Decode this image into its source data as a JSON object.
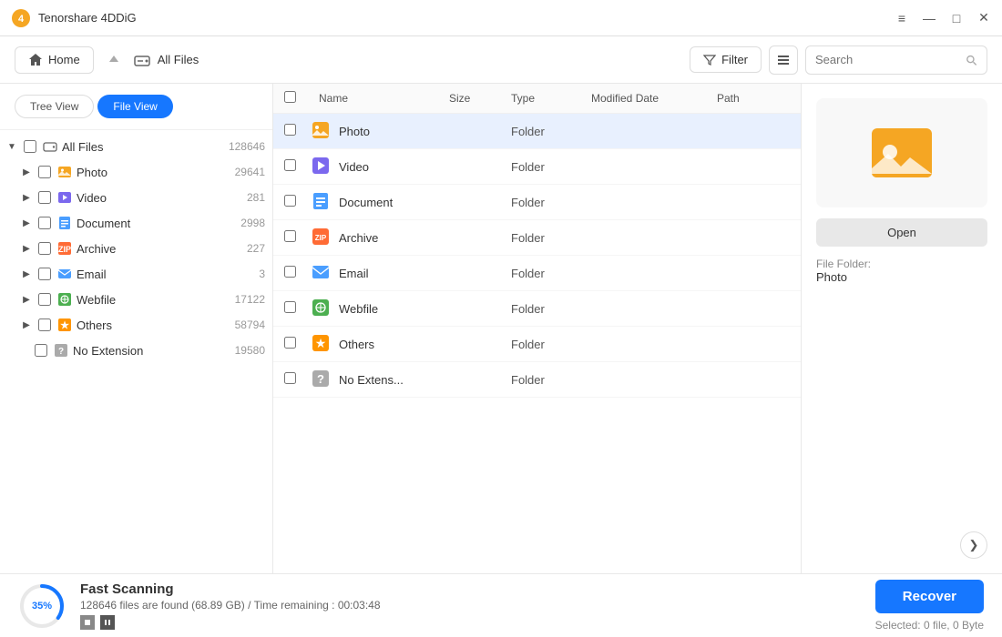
{
  "app": {
    "title": "Tenorshare 4DDiG",
    "logo_color": "#f5a623"
  },
  "titlebar": {
    "controls": {
      "menu": "≡",
      "minimize": "—",
      "maximize": "□",
      "close": "✕"
    }
  },
  "toolbar": {
    "home_label": "Home",
    "nav_up": "↑",
    "breadcrumb": "All Files",
    "filter_label": "Filter",
    "search_placeholder": "Search"
  },
  "sidebar": {
    "view_toggle": {
      "tree_view": "Tree View",
      "file_view": "File View"
    },
    "items": [
      {
        "id": "all-files",
        "label": "All Files",
        "count": "128646",
        "indent": 0,
        "has_arrow": true,
        "expanded": true,
        "icon": "hdd"
      },
      {
        "id": "photo",
        "label": "Photo",
        "count": "29641",
        "indent": 1,
        "has_arrow": true,
        "expanded": false,
        "icon": "photo"
      },
      {
        "id": "video",
        "label": "Video",
        "count": "281",
        "indent": 1,
        "has_arrow": true,
        "expanded": false,
        "icon": "video"
      },
      {
        "id": "document",
        "label": "Document",
        "count": "2998",
        "indent": 1,
        "has_arrow": true,
        "expanded": false,
        "icon": "document"
      },
      {
        "id": "archive",
        "label": "Archive",
        "count": "227",
        "indent": 1,
        "has_arrow": true,
        "expanded": false,
        "icon": "archive"
      },
      {
        "id": "email",
        "label": "Email",
        "count": "3",
        "indent": 1,
        "has_arrow": true,
        "expanded": false,
        "icon": "email"
      },
      {
        "id": "webfile",
        "label": "Webfile",
        "count": "17122",
        "indent": 1,
        "has_arrow": true,
        "expanded": false,
        "icon": "webfile"
      },
      {
        "id": "others",
        "label": "Others",
        "count": "58794",
        "indent": 1,
        "has_arrow": true,
        "expanded": false,
        "icon": "others"
      },
      {
        "id": "noext",
        "label": "No Extension",
        "count": "19580",
        "indent": 1,
        "has_arrow": false,
        "expanded": false,
        "icon": "noext"
      }
    ]
  },
  "file_table": {
    "columns": [
      "Name",
      "Size",
      "Type",
      "Modified Date",
      "Path"
    ],
    "rows": [
      {
        "id": "photo",
        "name": "Photo",
        "size": "",
        "type": "Folder",
        "date": "",
        "path": "",
        "icon": "photo",
        "selected": true
      },
      {
        "id": "video",
        "name": "Video",
        "size": "",
        "type": "Folder",
        "date": "",
        "path": "",
        "icon": "video",
        "selected": false
      },
      {
        "id": "document",
        "name": "Document",
        "size": "",
        "type": "Folder",
        "date": "",
        "path": "",
        "icon": "document",
        "selected": false
      },
      {
        "id": "archive",
        "name": "Archive",
        "size": "",
        "type": "Folder",
        "date": "",
        "path": "",
        "icon": "archive",
        "selected": false
      },
      {
        "id": "email",
        "name": "Email",
        "size": "",
        "type": "Folder",
        "date": "",
        "path": "",
        "icon": "email",
        "selected": false
      },
      {
        "id": "webfile",
        "name": "Webfile",
        "size": "",
        "type": "Folder",
        "date": "",
        "path": "",
        "icon": "webfile",
        "selected": false
      },
      {
        "id": "others",
        "name": "Others",
        "size": "",
        "type": "Folder",
        "date": "",
        "path": "",
        "icon": "others",
        "selected": false
      },
      {
        "id": "noext",
        "name": "No Extens...",
        "size": "",
        "type": "Folder",
        "date": "",
        "path": "",
        "icon": "noext",
        "selected": false
      }
    ]
  },
  "preview": {
    "open_label": "Open",
    "info_label": "File Folder:",
    "info_value": "Photo",
    "nav_next": "❯"
  },
  "bottom": {
    "progress_percent": "35%",
    "scan_title": "Fast Scanning",
    "scan_detail": "128646 files are found (68.89 GB) /  Time remaining : 00:03:48",
    "recover_label": "Recover",
    "selected_info": "Selected: 0 file, 0 Byte"
  }
}
